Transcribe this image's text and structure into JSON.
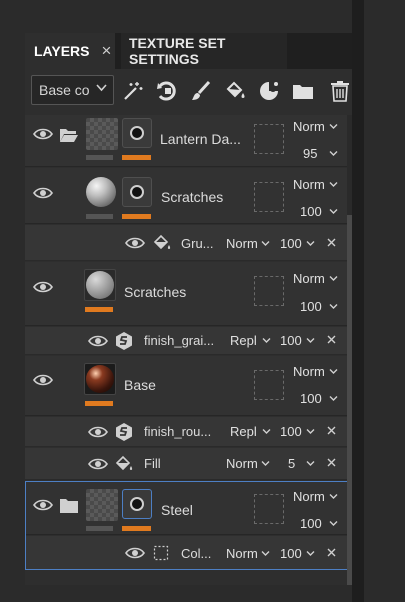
{
  "tabs": [
    {
      "label": "LAYERS",
      "close": "×"
    },
    {
      "label": "TEXTURE SET SETTINGS"
    }
  ],
  "toolbar": {
    "channel_select": "Base co",
    "icons": [
      "magic-wand-icon",
      "add-mask-icon",
      "paint-brush-icon",
      "fill-bucket-icon",
      "effects-icon",
      "folder-icon",
      "trash-icon"
    ]
  },
  "layers": [
    {
      "name": "Lantern Da...",
      "blend": "Norm",
      "opacity": "95",
      "type": "folder-paint"
    },
    {
      "name": "Scratches",
      "blend": "Norm",
      "opacity": "100",
      "type": "fill-mask"
    },
    {
      "name": "Gru...",
      "blend": "Norm",
      "opacity": "100",
      "type": "fill-effect"
    },
    {
      "name": "Scratches",
      "blend": "Norm",
      "opacity": "100",
      "type": "fill"
    },
    {
      "name": "finish_grai...",
      "blend": "Repl",
      "opacity": "100",
      "type": "substance-effect"
    },
    {
      "name": "Base",
      "blend": "Norm",
      "opacity": "100",
      "type": "fill"
    },
    {
      "name": "finish_rou...",
      "blend": "Repl",
      "opacity": "100",
      "type": "substance-effect"
    },
    {
      "name": "Fill",
      "blend": "Norm",
      "opacity": "5",
      "type": "fill-effect"
    },
    {
      "name": "Steel",
      "blend": "Norm",
      "opacity": "100",
      "type": "folder"
    },
    {
      "name": "Col...",
      "blend": "Norm",
      "opacity": "100",
      "type": "color-effect"
    }
  ],
  "colors": {
    "accent": "#e07a1f",
    "selection": "#4d7fc4"
  }
}
